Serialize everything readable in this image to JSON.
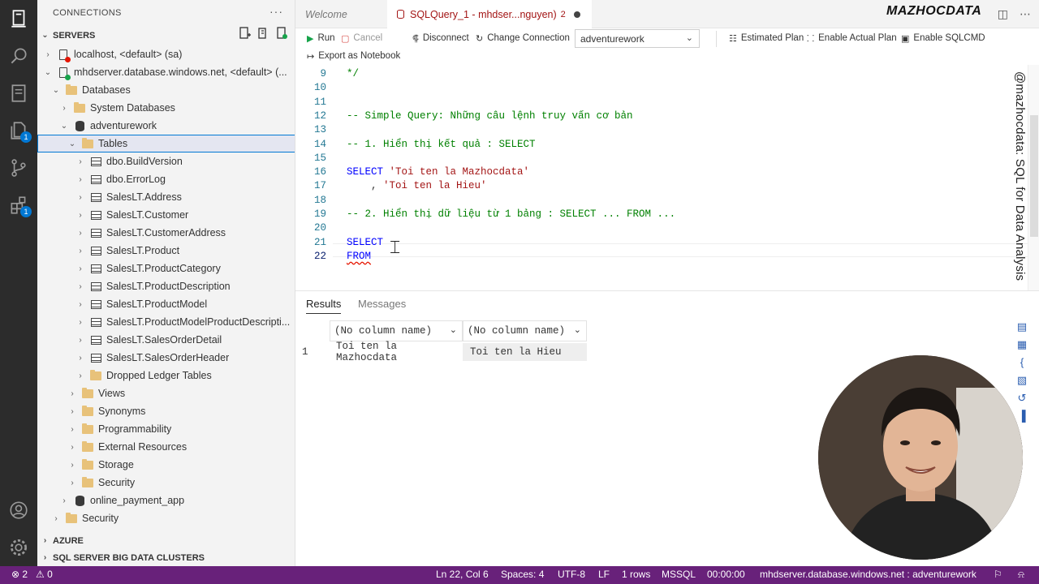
{
  "sidebar": {
    "title": "CONNECTIONS",
    "more": "···",
    "servers_header": "SERVERS",
    "azure_header": "AZURE",
    "bigdata_header": "SQL SERVER BIG DATA CLUSTERS",
    "tree": [
      {
        "label": "localhost, <default> (sa)",
        "depth": 0,
        "twisty": "›",
        "icon": "server-icon"
      },
      {
        "label": "mhdserver.database.windows.net, <default> (...",
        "depth": 0,
        "twisty": "⌄",
        "icon": "server-icon"
      },
      {
        "label": "Databases",
        "depth": 1,
        "twisty": "⌄",
        "icon": "folder-icon"
      },
      {
        "label": "System Databases",
        "depth": 2,
        "twisty": "›",
        "icon": "folder-icon"
      },
      {
        "label": "adventurework",
        "depth": 2,
        "twisty": "⌄",
        "icon": "database-icon"
      },
      {
        "label": "Tables",
        "depth": 3,
        "twisty": "⌄",
        "icon": "folder-icon"
      },
      {
        "label": "dbo.BuildVersion",
        "depth": 4,
        "twisty": "›",
        "icon": "table-icon"
      },
      {
        "label": "dbo.ErrorLog",
        "depth": 4,
        "twisty": "›",
        "icon": "table-icon"
      },
      {
        "label": "SalesLT.Address",
        "depth": 4,
        "twisty": "›",
        "icon": "table-icon"
      },
      {
        "label": "SalesLT.Customer",
        "depth": 4,
        "twisty": "›",
        "icon": "table-icon"
      },
      {
        "label": "SalesLT.CustomerAddress",
        "depth": 4,
        "twisty": "›",
        "icon": "table-icon"
      },
      {
        "label": "SalesLT.Product",
        "depth": 4,
        "twisty": "›",
        "icon": "table-icon"
      },
      {
        "label": "SalesLT.ProductCategory",
        "depth": 4,
        "twisty": "›",
        "icon": "table-icon"
      },
      {
        "label": "SalesLT.ProductDescription",
        "depth": 4,
        "twisty": "›",
        "icon": "table-icon"
      },
      {
        "label": "SalesLT.ProductModel",
        "depth": 4,
        "twisty": "›",
        "icon": "table-icon"
      },
      {
        "label": "SalesLT.ProductModelProductDescripti...",
        "depth": 4,
        "twisty": "›",
        "icon": "table-icon"
      },
      {
        "label": "SalesLT.SalesOrderDetail",
        "depth": 4,
        "twisty": "›",
        "icon": "table-icon"
      },
      {
        "label": "SalesLT.SalesOrderHeader",
        "depth": 4,
        "twisty": "›",
        "icon": "table-icon"
      },
      {
        "label": "Dropped Ledger Tables",
        "depth": 4,
        "twisty": "›",
        "icon": "folder-icon"
      },
      {
        "label": "Views",
        "depth": 3,
        "twisty": "›",
        "icon": "folder-icon"
      },
      {
        "label": "Synonyms",
        "depth": 3,
        "twisty": "›",
        "icon": "folder-icon"
      },
      {
        "label": "Programmability",
        "depth": 3,
        "twisty": "›",
        "icon": "folder-icon"
      },
      {
        "label": "External Resources",
        "depth": 3,
        "twisty": "›",
        "icon": "folder-icon"
      },
      {
        "label": "Storage",
        "depth": 3,
        "twisty": "›",
        "icon": "folder-icon"
      },
      {
        "label": "Security",
        "depth": 3,
        "twisty": "›",
        "icon": "folder-icon"
      },
      {
        "label": "online_payment_app",
        "depth": 2,
        "twisty": "›",
        "icon": "database-icon"
      },
      {
        "label": "Security",
        "depth": 1,
        "twisty": "›",
        "icon": "folder-icon"
      }
    ]
  },
  "tabs": {
    "welcome": "Welcome",
    "active": "SQLQuery_1 - mhdser...nguyen)",
    "active_problems": "2",
    "logo": "MAZHOCDATA"
  },
  "toolbar": {
    "run": "Run",
    "cancel": "Cancel",
    "disconnect": "Disconnect",
    "change_connection": "Change Connection",
    "database": "adventurework",
    "estimated_plan": "Estimated Plan",
    "enable_actual_plan": "Enable Actual Plan",
    "enable_sqlcmd": "Enable SQLCMD",
    "export_notebook": "Export as Notebook"
  },
  "editor": {
    "lines": [
      {
        "n": "9",
        "text": "*/",
        "cls": "cmt"
      },
      {
        "n": "10",
        "text": "",
        "cls": ""
      },
      {
        "n": "11",
        "text": "",
        "cls": ""
      },
      {
        "n": "12",
        "text": "-- Simple Query: Những câu lệnh truy vấn cơ bản",
        "cls": "cmt"
      },
      {
        "n": "13",
        "text": "",
        "cls": ""
      },
      {
        "n": "14",
        "text": "-- 1. Hiển thị kết quả : SELECT",
        "cls": "cmt"
      },
      {
        "n": "15",
        "text": "",
        "cls": ""
      },
      {
        "n": "16",
        "kw": "SELECT ",
        "str": "'Toi ten la Mazhocdata'"
      },
      {
        "n": "17",
        "pre": "    , ",
        "str": "'Toi ten la Hieu'"
      },
      {
        "n": "18",
        "text": "",
        "cls": ""
      },
      {
        "n": "19",
        "text": "-- 2. Hiển thị dữ liệu từ 1 bảng : SELECT ... FROM ...",
        "cls": "cmt"
      },
      {
        "n": "20",
        "text": "",
        "cls": ""
      },
      {
        "n": "21",
        "text": "SELECT",
        "cls": "kw"
      },
      {
        "n": "22",
        "text": "FROM",
        "cls": "kw squig"
      }
    ]
  },
  "results": {
    "tab_results": "Results",
    "tab_messages": "Messages",
    "col1": "(No column name)",
    "col2": "(No column name)",
    "row_num": "1",
    "cell1": "Toi ten la Mazhocdata",
    "cell2": "Toi ten la Hieu"
  },
  "watermark": "@mazhocdata: SQL for Data Analysis",
  "status": {
    "errors": "⊗ 2",
    "warnings": "⚠ 0",
    "position": "Ln 22, Col 6",
    "spaces": "Spaces: 4",
    "encoding": "UTF-8",
    "eol": "LF",
    "rows": "1 rows",
    "language": "MSSQL",
    "time": "00:00:00",
    "connection": "mhdserver.database.windows.net : adventurework"
  },
  "colors": {
    "status_bar": "#68217a",
    "accent": "#0078d4",
    "comment": "#008000",
    "keyword": "#0000ff",
    "string": "#a31515"
  }
}
